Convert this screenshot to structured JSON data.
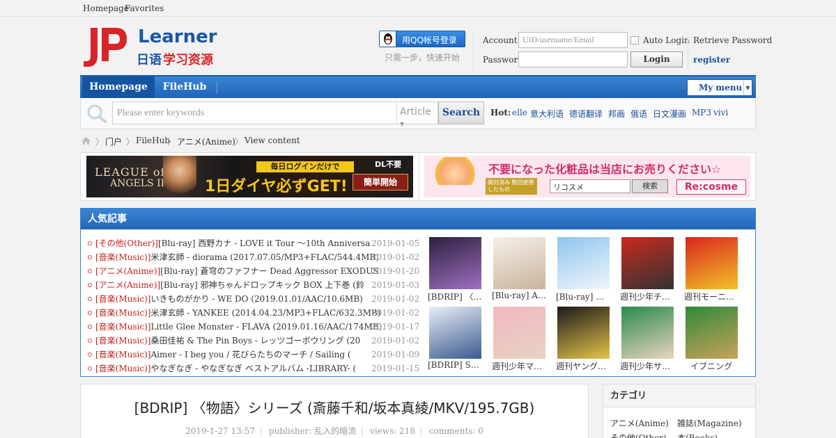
{
  "topbar": {
    "homepage": "Homepage",
    "favorites": "Favorites"
  },
  "logo": {
    "letters": "JP",
    "word": "Learner",
    "subtitle_a": "日语",
    "subtitle_b": "学习资源"
  },
  "qq": {
    "button": "用QQ帐号登录",
    "sub": "只需一步，快速开始"
  },
  "login": {
    "account_label": "Account",
    "account_placeholder": "UID/username/Email",
    "password_label": "Password",
    "auto_login": "Auto Login",
    "login_button": "Login",
    "retrieve": "Retrieve Password",
    "register": "register"
  },
  "nav": {
    "items": [
      "Homepage",
      "FileHub"
    ],
    "my_menu": "My menu"
  },
  "search": {
    "placeholder": "Please enter keywords",
    "type": "Article",
    "button": "Search",
    "hot_label": "Hot:",
    "hot": [
      "elle",
      "意大利语",
      "德语翻译",
      "邦画",
      "俄语",
      "日文漫画",
      "MP3",
      "vivi"
    ]
  },
  "breadcrumb": [
    "门户",
    "FileHub",
    "アニメ(Anime)",
    "View content"
  ],
  "banner1": {
    "t1": "LEAGUE of",
    "t2": "ANGELS II",
    "top": "毎日ログインだけで",
    "main": "1日ダイヤ必ずGET!",
    "dl": "DL不要",
    "go": "簡単開始"
  },
  "banner2": {
    "head": "不要になった化粧品は当店にお売りください☆",
    "sub": "開封済み 数回使用したもの",
    "input": "リコスメ",
    "button": "検索",
    "brand": "Re:cosme"
  },
  "popular": {
    "title": "人気記事",
    "rows": [
      {
        "cat": "[その他(Other)]",
        "title": "[Blu-ray] 西野カナ - LOVE it Tour 〜10th Anniversa",
        "date": "2019-01-05"
      },
      {
        "cat": "[音楽(Music)]",
        "title": "米津玄師 - diorama (2017.07.05/MP3+FLAC/544.4MB)",
        "date": "2019-01-02"
      },
      {
        "cat": "[アニメ(Anime)]",
        "title": "[Blu-ray] 蒼穹のファフナー Dead Aggressor EXODUS",
        "date": "2019-01-20"
      },
      {
        "cat": "[アニメ(Anime)]",
        "title": "[Blu-ray] 邪神ちゃんドロップキック BOX 上下巻 (鈴",
        "date": "2019-01-03"
      },
      {
        "cat": "[音楽(Music)]",
        "title": "いきものがかり - WE DO (2019.01.01/AAC/10.6MB)",
        "date": "2019-01-02"
      },
      {
        "cat": "[音楽(Music)]",
        "title": "米津玄師 - YANKEE (2014.04.23/MP3+FLAC/632.3MB)",
        "date": "2019-01-02"
      },
      {
        "cat": "[音楽(Music)]",
        "title": "Little Glee Monster - FLAVA (2019.01.16/AAC/174MB)",
        "date": "2019-01-17"
      },
      {
        "cat": "[音楽(Music)]",
        "title": "桑田佳祐 & The Pin Boys - レッツゴーボウリング (20",
        "date": "2019-01-02"
      },
      {
        "cat": "[音楽(Music)]",
        "title": "Aimer - I beg you / 花びらたちのマーチ / Sailing (",
        "date": "2019-01-09"
      },
      {
        "cat": "[音楽(Music)]",
        "title": "やなぎなぎ - やなぎなぎ ベストアルバム -LIBRARY- (",
        "date": "2019-01-15"
      }
    ],
    "thumbs": [
      {
        "caption": "[BDRIP] 〈物語〉シリーズ",
        "c1": "#2a2040",
        "c2": "#a070c0"
      },
      {
        "caption": "[Blu-ray] Angel Beats!",
        "c1": "#f4f0ea",
        "c2": "#c9b49a"
      },
      {
        "caption": "[Blu-ray] ヴァイオレット",
        "c1": "#8fc6ee",
        "c2": "#f0f6fb"
      },
      {
        "caption": "週刊少年チャンピオン",
        "c1": "#c82a1e",
        "c2": "#333333"
      },
      {
        "caption": "週刊モーニング",
        "c1": "#d8261d",
        "c2": "#f2c22a"
      },
      {
        "caption": "[BDRIP] STEINS;GATE",
        "c1": "#e8eef6",
        "c2": "#3a5a90"
      },
      {
        "caption": "週刊少年マガジン",
        "c1": "#f2b8c2",
        "c2": "#e7d2c2"
      },
      {
        "caption": "週刊ヤングジャンプ",
        "c1": "#1a1a1a",
        "c2": "#e6c44a"
      },
      {
        "caption": "週刊少年サンデー",
        "c1": "#2a8a4a",
        "c2": "#e8d4c0"
      },
      {
        "caption": "イブニング",
        "c1": "#2f8a3a",
        "c2": "#c9a25a"
      }
    ]
  },
  "article": {
    "title": "[BDRIP] 〈物語〉シリーズ (斎藤千和/坂本真綾/MKV/195.7GB)",
    "date": "2019-1-27 13:57",
    "publisher": "publisher: 乱入的暗流",
    "views": "views: 218",
    "comments": "comments: 0"
  },
  "sidebar": {
    "title": "カテゴリ",
    "items": [
      "アニメ(Anime)",
      "雑誌(Magazine)",
      "その他(Other)",
      "本(Books)"
    ]
  },
  "colors": {
    "accent_blue": "#2366b9",
    "category_red": "#c8201a",
    "link_blue": "#1a4f9c"
  }
}
